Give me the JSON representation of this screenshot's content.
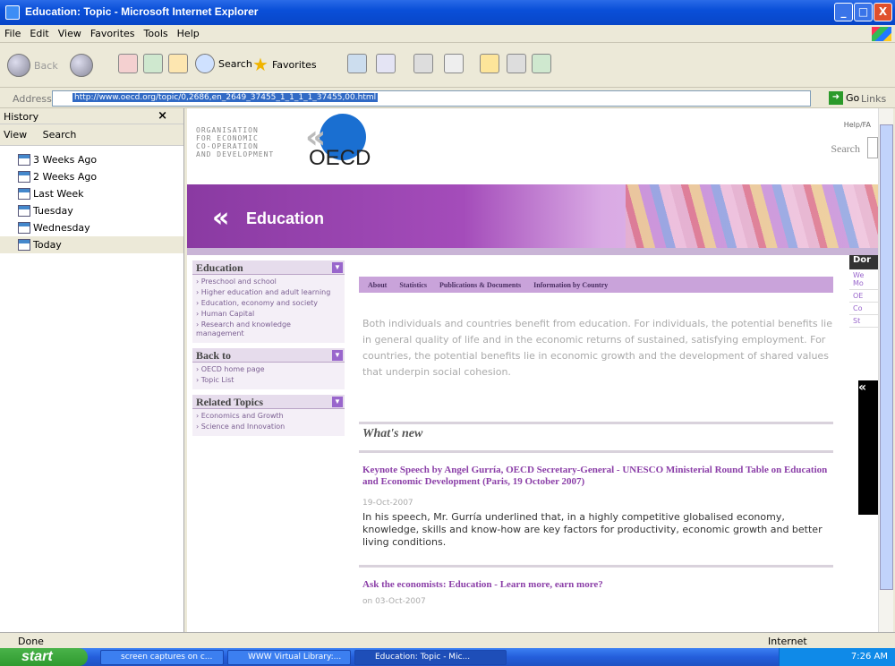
{
  "window": {
    "title": "Education: Topic - Microsoft Internet Explorer",
    "min": "_",
    "max": "□",
    "close": "X"
  },
  "menu": [
    "File",
    "Edit",
    "View",
    "Favorites",
    "Tools",
    "Help"
  ],
  "toolbar": {
    "back": "Back",
    "search": "Search",
    "favorites": "Favorites"
  },
  "address": {
    "label": "Address",
    "url": "http://www.oecd.org/topic/0,2686,en_2649_37455_1_1_1_1_37455,00.html",
    "go": "Go",
    "links": "Links"
  },
  "history": {
    "title": "History",
    "close": "×",
    "view": "View",
    "search": "Search",
    "items": [
      "3 Weeks Ago",
      "2 Weeks Ago",
      "Last Week",
      "Tuesday",
      "Wednesday",
      "Today"
    ]
  },
  "page": {
    "org_line1": "ORGANISATION",
    "org_line2": "FOR ECONOMIC",
    "org_line3": "CO-OPERATION",
    "org_line4": "AND DEVELOPMENT",
    "logo_text": "OECD",
    "help": "Help/FA",
    "search": "Search",
    "banner_title": "Education",
    "nav": {
      "education": {
        "title": "Education",
        "items": [
          "Preschool and school",
          "Higher education and adult learning",
          "Education, economy and society",
          "Human Capital",
          "Research and knowledge management"
        ]
      },
      "back": {
        "title": "Back to",
        "items": [
          "OECD home page",
          "Topic List"
        ]
      },
      "related": {
        "title": "Related Topics",
        "items": [
          "Economics and Growth",
          "Science and Innovation"
        ]
      }
    },
    "tabs": [
      "About",
      "Statistics",
      "Publications & Documents",
      "Information by Country"
    ],
    "intro": "Both individuals and countries benefit from education. For individuals, the potential benefits lie in general quality of life and in the economic returns of sustained, satisfying employment. For countries, the potential benefits lie in economic growth and the development of shared values that underpin social cohesion.",
    "whatsnew": "What's new",
    "news1": {
      "title": "Keynote Speech by Angel Gurría, OECD Secretary-General - UNESCO Ministerial Round Table on Education and Economic Development (Paris, 19 October 2007)",
      "date": "19-Oct-2007",
      "body": "In his speech, Mr. Gurría underlined that, in a highly competitive globalised economy, knowledge, skills and know-how are key factors for productivity, economic growth and better living conditions."
    },
    "news2": {
      "title": "Ask the economists: Education - Learn more, earn more?",
      "date": "on 03-Oct-2007"
    },
    "right": {
      "header": "Dor",
      "links": [
        "We Mo",
        "OE",
        "Co",
        "St"
      ]
    }
  },
  "status": {
    "text": "Done",
    "zone": "Internet"
  },
  "taskbar": {
    "start": "start",
    "tasks": [
      "screen captures on c...",
      "WWW Virtual Library:...",
      "Education: Topic - Mic..."
    ],
    "clock": "7:26 AM"
  }
}
